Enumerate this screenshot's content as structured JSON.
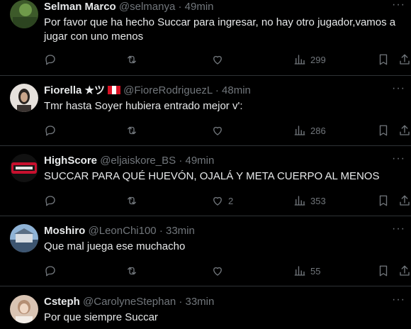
{
  "tweets": [
    {
      "name": "Selman Marco",
      "handle": "@selmanya",
      "dot": "·",
      "time": "49min",
      "text": "Por favor que ha hecho Succar para  ingresar, no hay otro jugador,vamos a jugar con uno menos",
      "likes": "",
      "views": "299"
    },
    {
      "name": "Fiorella ★ツ",
      "handle": "@FioreRodriguezL",
      "dot": "·",
      "time": "48min",
      "text": "Tmr hasta Soyer hubiera entrado mejor v':",
      "likes": "",
      "views": "286"
    },
    {
      "name": "HighScore",
      "handle": "@eljaiskore_BS",
      "dot": "·",
      "time": "49min",
      "text": "SUCCAR PARA QUÉ HUEVÓN, OJALÁ Y META CUERPO AL MENOS",
      "likes": "2",
      "views": "353"
    },
    {
      "name": "Moshiro",
      "handle": "@LeonChi100",
      "dot": "·",
      "time": "33min",
      "text": "Que mal juega ese muchacho",
      "likes": "",
      "views": "55"
    },
    {
      "name": "Csteph",
      "handle": "@CarolyneStephan",
      "dot": "·",
      "time": "33min",
      "text": "Por que siempre Succar"
    }
  ],
  "more_glyph": "···",
  "colors": {
    "background": "#000000",
    "text": "#e7e9ea",
    "muted": "#71767b",
    "divider": "#2f3336"
  },
  "icons": [
    "reply-icon",
    "retweet-icon",
    "like-icon",
    "views-icon",
    "bookmark-icon",
    "share-icon",
    "more-icon"
  ]
}
